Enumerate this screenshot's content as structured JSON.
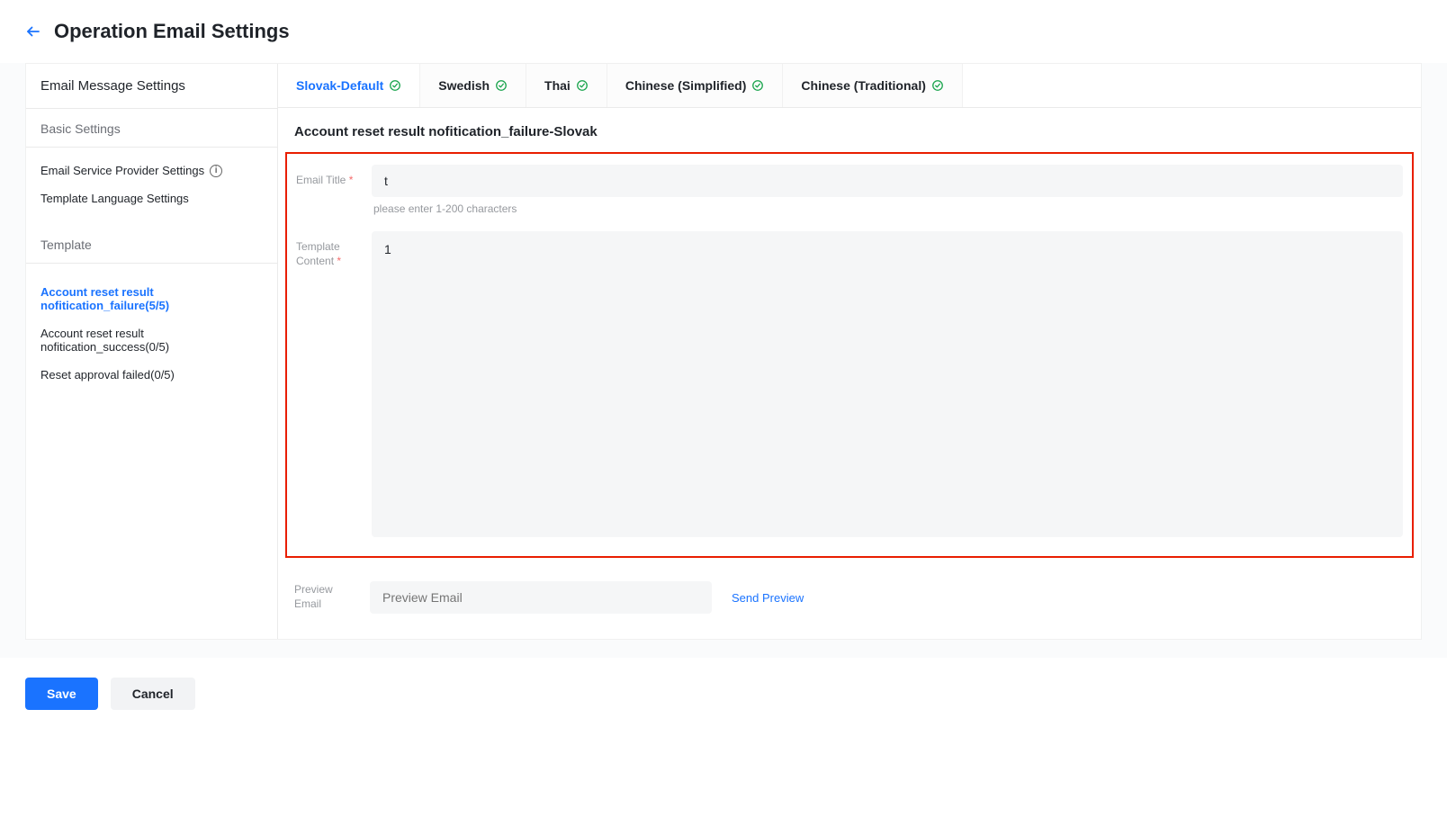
{
  "header": {
    "back_icon": "back-arrow",
    "title": "Operation Email Settings"
  },
  "sidebar": {
    "title": "Email Message Settings",
    "section_basic": "Basic Settings",
    "links": {
      "provider": "Email Service Provider Settings",
      "lang": "Template Language Settings"
    },
    "section_template": "Template",
    "templates": [
      {
        "label": "Account reset result nofitication_failure(5/5)",
        "active": true
      },
      {
        "label": "Account reset result nofitication_success(0/5)",
        "active": false
      },
      {
        "label": "Reset approval failed(0/5)",
        "active": false
      }
    ]
  },
  "tabs": [
    {
      "label": "Slovak-Default",
      "active": true
    },
    {
      "label": "Swedish",
      "active": false
    },
    {
      "label": "Thai",
      "active": false
    },
    {
      "label": "Chinese (Simplified)",
      "active": false
    },
    {
      "label": "Chinese (Traditional)",
      "active": false
    }
  ],
  "content": {
    "heading": "Account reset result nofitication_failure-Slovak",
    "title_label": "Email Title",
    "title_value": "t",
    "title_hint": "please enter 1-200 characters",
    "body_label": "Template Content",
    "body_value": "1",
    "preview_label": "Preview Email",
    "preview_placeholder": "Preview Email",
    "send_preview": "Send Preview"
  },
  "footer": {
    "save": "Save",
    "cancel": "Cancel"
  }
}
